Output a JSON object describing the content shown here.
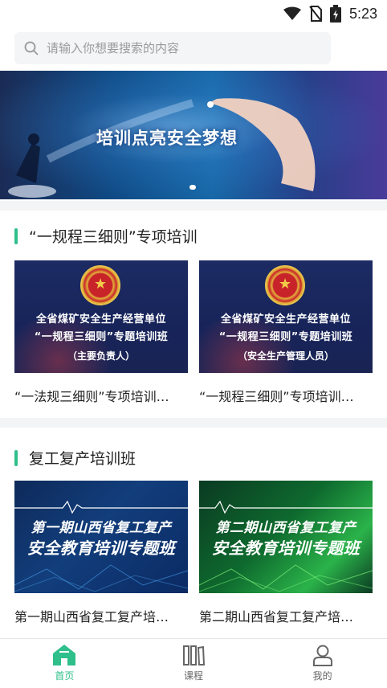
{
  "status_bar": {
    "time": "5:23",
    "icons": [
      "wifi-icon",
      "no-sim-icon",
      "battery-charging-icon"
    ]
  },
  "search": {
    "placeholder": "请输入你想要搜索的内容"
  },
  "banner": {
    "title": "培训点亮安全梦想"
  },
  "colors": {
    "accent": "#2fbf8a",
    "tab_inactive": "#666666"
  },
  "sections": [
    {
      "title": "“一规程三细则”专项培训",
      "cards": [
        {
          "caption": "“一法规三细则”专项培训…",
          "line1": "全省煤矿安全生产经营单位",
          "line2": "“一规程三细则”专题培训班",
          "line3": "（主要负责人）"
        },
        {
          "caption": "“一规程三细则”专项培训…",
          "line1": "全省煤矿安全生产经营单位",
          "line2": "“一规程三细则”专题培训班",
          "line3": "（安全生产管理人员）"
        }
      ]
    },
    {
      "title": "复工复产培训班",
      "cards": [
        {
          "caption": "第一期山西省复工复产培…",
          "line1": "第一期山西省复工复产",
          "line2": "安全教育培训专题班"
        },
        {
          "caption": "第二期山西省复工复产培…",
          "line1": "第二期山西省复工复产",
          "line2": "安全教育培训专题班"
        }
      ]
    }
  ],
  "tabbar": {
    "items": [
      {
        "label": "首页",
        "icon": "home-icon",
        "active": true
      },
      {
        "label": "课程",
        "icon": "books-icon",
        "active": false
      },
      {
        "label": "我的",
        "icon": "user-icon",
        "active": false
      }
    ]
  }
}
